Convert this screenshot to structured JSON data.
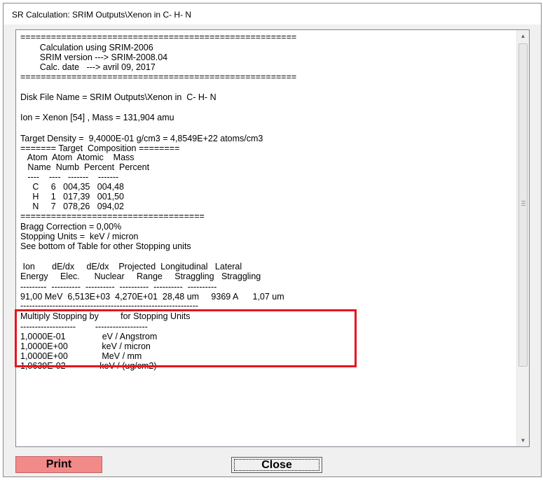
{
  "window": {
    "title": "SR Calculation: SRIM Outputs\\Xenon in  C- H- N"
  },
  "report_lines": [
    "======================================================",
    "        Calculation using SRIM-2006",
    "        SRIM version ---> SRIM-2008.04",
    "        Calc. date   ---> avril 09, 2017",
    "======================================================",
    "",
    "Disk File Name = SRIM Outputs\\Xenon in  C- H- N",
    "",
    "Ion = Xenon [54] , Mass = 131,904 amu",
    "",
    "Target Density =  9,4000E-01 g/cm3 = 4,8549E+22 atoms/cm3",
    "======= Target  Composition ========",
    "   Atom  Atom  Atomic    Mass",
    "   Name  Numb  Percent  Percent",
    "   ----    ----   -------    -------",
    "     C     6   004,35   004,48",
    "     H     1   017,39   001,50",
    "     N     7   078,26   094,02",
    "====================================",
    "Bragg Correction = 0,00%",
    "Stopping Units =  keV / micron",
    "See bottom of Table for other Stopping units",
    "",
    " Ion       dE/dx     dE/dx    Projected  Longitudinal   Lateral",
    "Energy     Elec.      Nuclear     Range     Straggling   Straggling",
    "---------  ----------  ----------  ----------  ----------  ----------",
    "91,00 MeV  6,513E+03  4,270E+01  28,48 um     9369 A      1,07 um",
    "-------------------------------------------------------------",
    "Multiply Stopping by         for Stopping Units",
    "-------------------        ------------------",
    "1,0000E-01               eV / Angstrom",
    "1,0000E+00              keV / micron",
    "1,0000E+00              MeV / mm",
    "1,0639E-02              keV / (ug/cm2)"
  ],
  "scrollbar": {
    "up_arrow": "▲",
    "down_arrow": "▼"
  },
  "buttons": {
    "print": "Print",
    "close": "Close"
  }
}
